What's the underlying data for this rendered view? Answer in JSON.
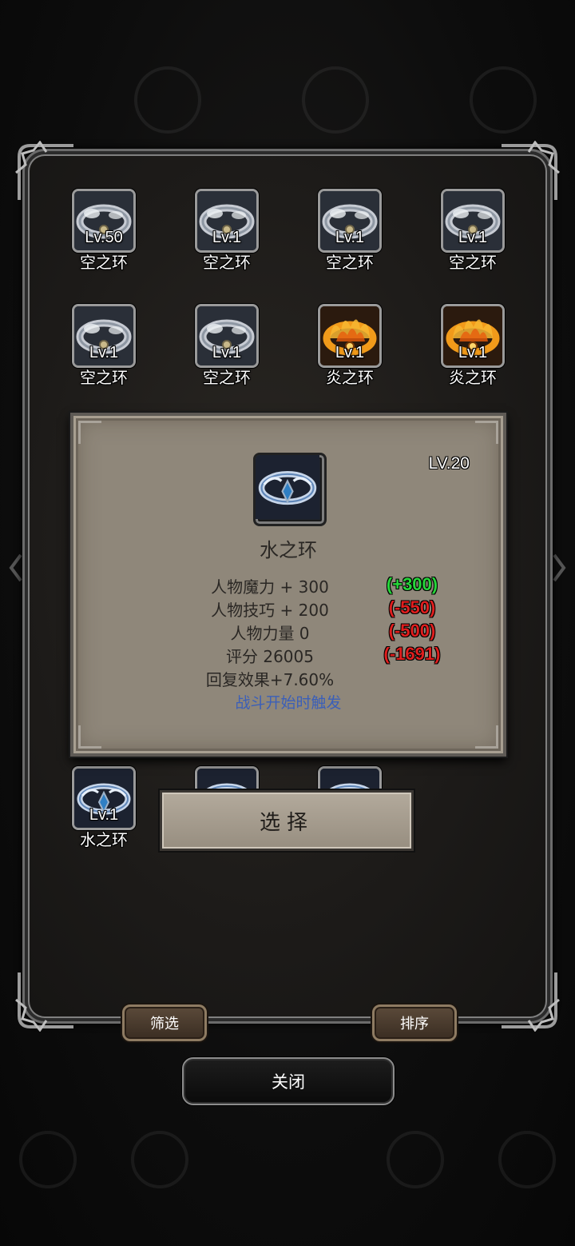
{
  "items": [
    {
      "level": "Lv.50",
      "name": "空之环",
      "element": "air"
    },
    {
      "level": "Lv.1",
      "name": "空之环",
      "element": "air"
    },
    {
      "level": "Lv.1",
      "name": "空之环",
      "element": "air"
    },
    {
      "level": "Lv.1",
      "name": "空之环",
      "element": "air"
    },
    {
      "level": "Lv.1",
      "name": "空之环",
      "element": "air"
    },
    {
      "level": "Lv.1",
      "name": "空之环",
      "element": "air"
    },
    {
      "level": "Lv.1",
      "name": "炎之环",
      "element": "fire"
    },
    {
      "level": "Lv.1",
      "name": "炎之环",
      "element": "fire"
    },
    {
      "level": "Lv.1",
      "name": "水之环",
      "element": "water"
    },
    {
      "level": "",
      "name": "",
      "element": "water"
    },
    {
      "level": "",
      "name": "",
      "element": "water"
    }
  ],
  "detail": {
    "level": "LV.20",
    "name": "水之环",
    "stats": [
      {
        "label": "人物魔力 + 300",
        "diff": "(+300)",
        "trend": "up"
      },
      {
        "label": "人物技巧 + 200",
        "diff": "(-550)",
        "trend": "down"
      },
      {
        "label": "人物力量  0",
        "diff": "(-500)",
        "trend": "down"
      },
      {
        "label": "评分 26005",
        "diff": "(-1691)",
        "trend": "down"
      },
      {
        "label": "回复效果+7.60%",
        "diff": "",
        "trend": "none"
      }
    ],
    "trigger": "战斗开始时触发",
    "select_label": "选择"
  },
  "buttons": {
    "filter": "筛选",
    "sort": "排序",
    "close": "关闭"
  },
  "colors": {
    "stat_up": "#26d63a",
    "stat_down": "#e01e1e",
    "trigger_text": "#3b5fb8"
  }
}
